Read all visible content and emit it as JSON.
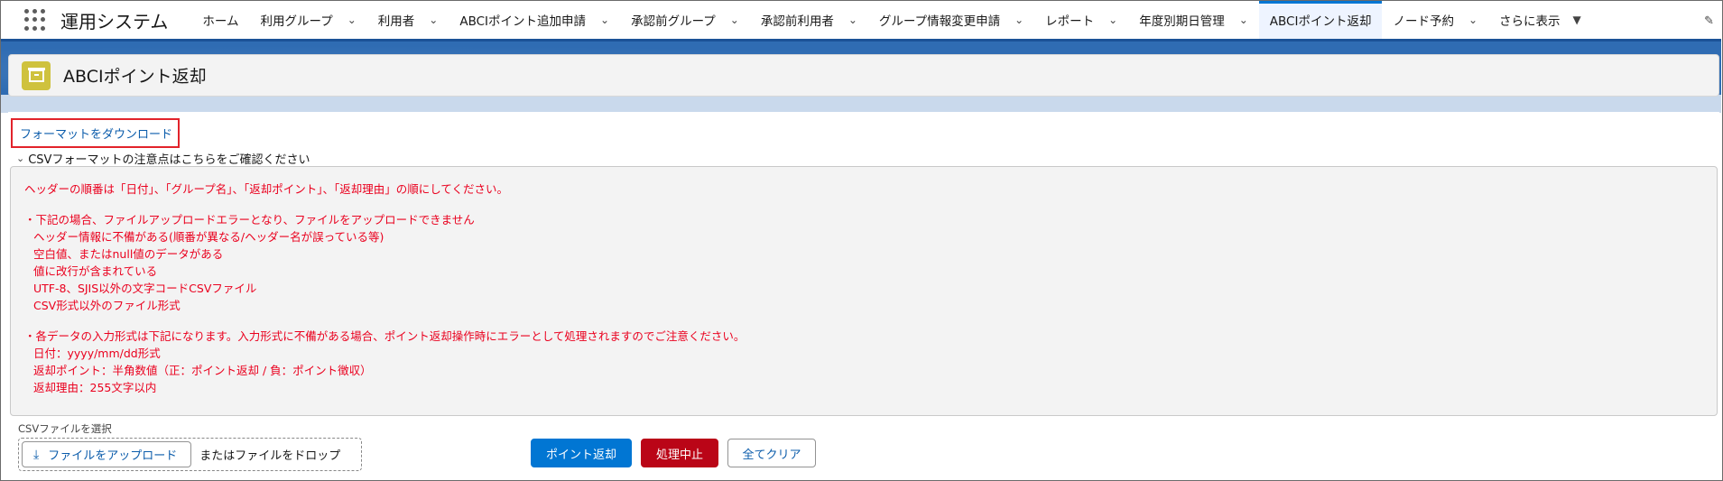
{
  "app": {
    "name": "運用システム"
  },
  "nav": {
    "items": [
      {
        "label": "ホーム",
        "has_dropdown": false
      },
      {
        "label": "利用グループ",
        "has_dropdown": true
      },
      {
        "label": "利用者",
        "has_dropdown": true
      },
      {
        "label": "ABCIポイント追加申請",
        "has_dropdown": true
      },
      {
        "label": "承認前グループ",
        "has_dropdown": true
      },
      {
        "label": "承認前利用者",
        "has_dropdown": true
      },
      {
        "label": "グループ情報変更申請",
        "has_dropdown": true
      },
      {
        "label": "レポート",
        "has_dropdown": true
      },
      {
        "label": "年度別期日管理",
        "has_dropdown": true
      },
      {
        "label": "ABCIポイント返却",
        "has_dropdown": false,
        "active": true
      },
      {
        "label": "ノード予約",
        "has_dropdown": true
      }
    ],
    "more_label": "さらに表示"
  },
  "page": {
    "title": "ABCIポイント返却",
    "icon": "archive-icon"
  },
  "download": {
    "label": "フォーマットをダウンロード"
  },
  "accordion": {
    "label": "CSVフォーマットの注意点はこちらをご確認ください"
  },
  "notes": {
    "header_order": "ヘッダーの順番は「日付」、「グループ名」、「返却ポイント」、「返却理由」の順にしてください。",
    "error_title": "・下記の場合、ファイルアップロードエラーとなり、ファイルをアップロードできません",
    "error_items": [
      "ヘッダー情報に不備がある(順番が異なる/ヘッダー名が誤っている等)",
      "空白値、またはnull値のデータがある",
      "値に改行が含まれている",
      "UTF-8、SJIS以外の文字コードCSVファイル",
      "CSV形式以外のファイル形式"
    ],
    "format_title": "・各データの入力形式は下記になります。入力形式に不備がある場合、ポイント返却操作時にエラーとして処理されますのでご注意ください。",
    "format_items": [
      "日付：yyyy/mm/dd形式",
      "返却ポイント：半角数値（正：ポイント返却 / 負：ポイント徴収）",
      "返却理由：255文字以内"
    ]
  },
  "upload": {
    "field_label": "CSVファイルを選択",
    "button_label": "ファイルをアップロード",
    "drop_text": "またはファイルをドロップ"
  },
  "actions": {
    "primary_label": "ポイント返却",
    "danger_label": "処理中止",
    "neutral_label": "全てクリア"
  },
  "colors": {
    "accent": "#0176d3",
    "danger": "#ba0517",
    "notice_text": "#ea001e",
    "header_icon": "#cfc23e",
    "nav_underline": "#1b5297"
  }
}
